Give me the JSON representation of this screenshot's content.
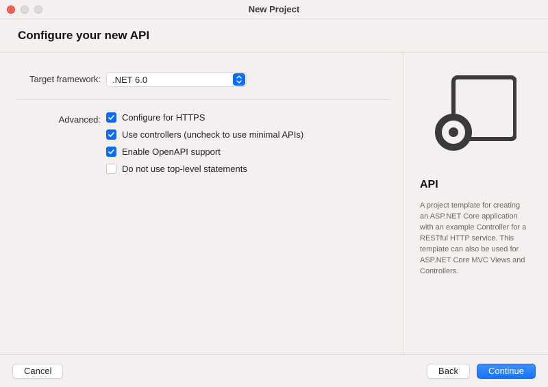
{
  "window": {
    "title": "New Project"
  },
  "header": {
    "title": "Configure your new API"
  },
  "form": {
    "target_framework_label": "Target framework:",
    "target_framework_value": ".NET 6.0",
    "advanced_label": "Advanced:",
    "checks": [
      {
        "label": "Configure for HTTPS",
        "checked": true
      },
      {
        "label": "Use controllers (uncheck to use minimal APIs)",
        "checked": true
      },
      {
        "label": "Enable OpenAPI support",
        "checked": true
      },
      {
        "label": "Do not use top-level statements",
        "checked": false
      }
    ]
  },
  "preview": {
    "title": "API",
    "description": "A project template for creating an ASP.NET Core application with an example Controller for a RESTful HTTP service. This template can also be used for ASP.NET Core MVC Views and Controllers."
  },
  "footer": {
    "cancel": "Cancel",
    "back": "Back",
    "continue": "Continue"
  }
}
